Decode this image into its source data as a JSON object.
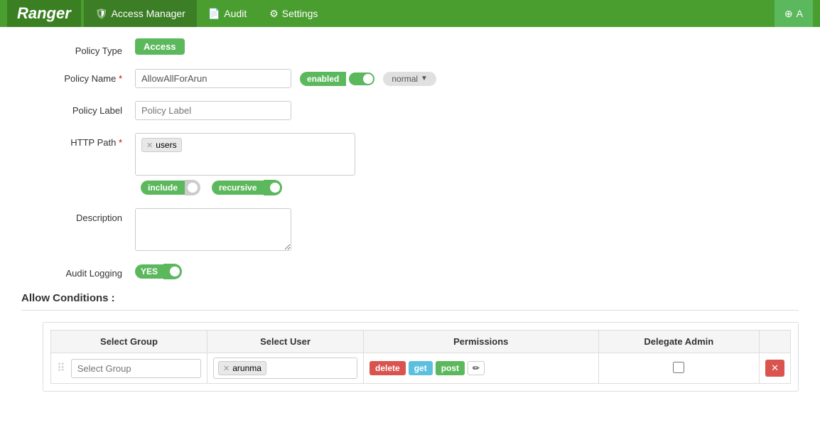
{
  "app": {
    "brand": "Ranger",
    "nav": [
      {
        "id": "access-manager",
        "label": "Access Manager",
        "icon": "🛡",
        "active": true
      },
      {
        "id": "audit",
        "label": "Audit",
        "icon": "📄",
        "active": false
      },
      {
        "id": "settings",
        "label": "Settings",
        "icon": "⚙",
        "active": false
      }
    ],
    "top_right_btn": "A"
  },
  "form": {
    "policy_type_label": "Policy Type",
    "policy_type_badge": "Access",
    "policy_name_label": "Policy Name",
    "policy_name_required": "*",
    "policy_name_value": "AllowAllForArun",
    "enabled_label": "enabled",
    "normal_label": "normal",
    "policy_label_label": "Policy Label",
    "policy_label_placeholder": "Policy Label",
    "http_path_label": "HTTP Path",
    "http_path_required": "*",
    "http_path_tag": "users",
    "include_label": "include",
    "recursive_label": "recursive",
    "description_label": "Description",
    "audit_logging_label": "Audit Logging",
    "audit_yes_label": "YES"
  },
  "allow_conditions": {
    "title": "Allow Conditions :",
    "table": {
      "col_group": "Select Group",
      "col_user": "Select User",
      "col_permissions": "Permissions",
      "col_delegate_admin": "Delegate Admin",
      "row": {
        "select_group_placeholder": "Select Group",
        "select_user_tag": "arunma",
        "permissions": [
          "delete",
          "get",
          "post"
        ],
        "delegate_checked": false
      }
    }
  }
}
